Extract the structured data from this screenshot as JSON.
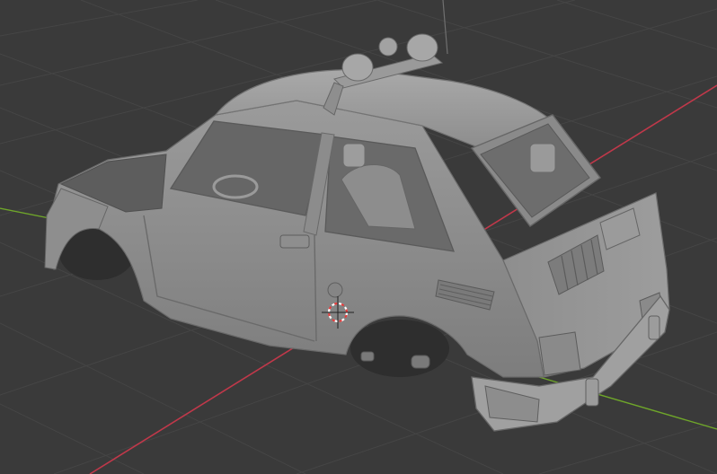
{
  "app": "Blender",
  "viewport": {
    "shading": "solid",
    "background_color": "#3a3a3a",
    "grid_color": "#444444",
    "axes": {
      "x_color": "#c0384a",
      "y_color": "#6fa62a"
    },
    "object": {
      "name": "car-body-model",
      "color": "#8f8f8f"
    },
    "cursor": {
      "name": "3d-cursor",
      "colors": [
        "#ffffff",
        "#e23b3b"
      ]
    }
  }
}
